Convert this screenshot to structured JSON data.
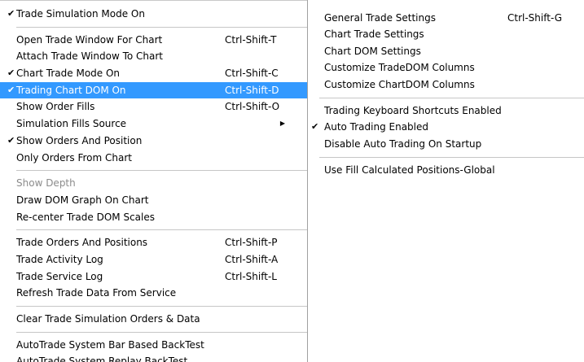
{
  "left_menu": {
    "items": [
      {
        "type": "item",
        "name": "trade-simulation-mode-item",
        "label": "Trade Simulation Mode On",
        "checked": true
      },
      {
        "type": "separator"
      },
      {
        "type": "item",
        "name": "open-trade-window-item",
        "label": "Open Trade Window For Chart",
        "shortcut": "Ctrl-Shift-T"
      },
      {
        "type": "item",
        "name": "attach-trade-window-item",
        "label": "Attach Trade Window To Chart"
      },
      {
        "type": "item",
        "name": "chart-trade-mode-item",
        "label": "Chart Trade Mode On",
        "shortcut": "Ctrl-Shift-C",
        "checked": true
      },
      {
        "type": "item",
        "name": "trading-chart-dom-item",
        "label": "Trading Chart DOM On",
        "shortcut": "Ctrl-Shift-D",
        "checked": true,
        "selected": true
      },
      {
        "type": "item",
        "name": "show-order-fills-item",
        "label": "Show Order Fills",
        "shortcut": "Ctrl-Shift-O"
      },
      {
        "type": "item",
        "name": "simulation-fills-source-item",
        "label": "Simulation Fills Source",
        "submenu": true
      },
      {
        "type": "item",
        "name": "show-orders-and-position-item",
        "label": "Show Orders And Position",
        "checked": true
      },
      {
        "type": "item",
        "name": "only-orders-from-chart-item",
        "label": "Only Orders From Chart"
      },
      {
        "type": "separator"
      },
      {
        "type": "item",
        "name": "show-depth-item",
        "label": "Show Depth",
        "disabled": true
      },
      {
        "type": "item",
        "name": "draw-dom-graph-item",
        "label": "Draw DOM Graph On Chart"
      },
      {
        "type": "item",
        "name": "recenter-trade-dom-scales-item",
        "label": "Re-center Trade DOM Scales"
      },
      {
        "type": "separator"
      },
      {
        "type": "item",
        "name": "trade-orders-and-positions-item",
        "label": "Trade Orders And Positions",
        "shortcut": "Ctrl-Shift-P"
      },
      {
        "type": "item",
        "name": "trade-activity-log-item",
        "label": "Trade Activity Log",
        "shortcut": "Ctrl-Shift-A"
      },
      {
        "type": "item",
        "name": "trade-service-log-item",
        "label": "Trade Service Log",
        "shortcut": "Ctrl-Shift-L"
      },
      {
        "type": "item",
        "name": "refresh-trade-data-item",
        "label": "Refresh Trade Data From Service"
      },
      {
        "type": "separator"
      },
      {
        "type": "item",
        "name": "clear-trade-simulation-item",
        "label": "Clear Trade Simulation Orders & Data"
      },
      {
        "type": "separator"
      },
      {
        "type": "item",
        "name": "autotrade-bar-backtest-item",
        "label": "AutoTrade System Bar Based BackTest"
      },
      {
        "type": "item",
        "name": "autotrade-replay-backtest-item",
        "label": "AutoTrade System Replay BackTest"
      }
    ]
  },
  "right_menu": {
    "items": [
      {
        "type": "item",
        "name": "general-trade-settings-item",
        "label": "General Trade Settings",
        "shortcut": "Ctrl-Shift-G"
      },
      {
        "type": "item",
        "name": "chart-trade-settings-item",
        "label": "Chart Trade Settings"
      },
      {
        "type": "item",
        "name": "chart-dom-settings-item",
        "label": "Chart DOM Settings"
      },
      {
        "type": "item",
        "name": "customize-tradedom-columns-item",
        "label": "Customize TradeDOM Columns"
      },
      {
        "type": "item",
        "name": "customize-chartdom-columns-item",
        "label": "Customize ChartDOM Columns"
      },
      {
        "type": "separator"
      },
      {
        "type": "item",
        "name": "trading-keyboard-shortcuts-item",
        "label": "Trading Keyboard Shortcuts Enabled"
      },
      {
        "type": "item",
        "name": "auto-trading-enabled-item",
        "label": "Auto Trading Enabled",
        "checked": true
      },
      {
        "type": "item",
        "name": "disable-auto-trading-startup-item",
        "label": "Disable Auto Trading On Startup"
      },
      {
        "type": "separator"
      },
      {
        "type": "item",
        "name": "use-fill-calculated-positions-item",
        "label": "Use Fill Calculated Positions-Global"
      }
    ]
  },
  "glyphs": {
    "check": "✔",
    "submenu_arrow": "▶"
  },
  "colors": {
    "selected_bg": "#3399ff",
    "selected_fg": "#ffffff",
    "disabled_fg": "#8c8c8c",
    "separator": "#c6c6c6"
  }
}
